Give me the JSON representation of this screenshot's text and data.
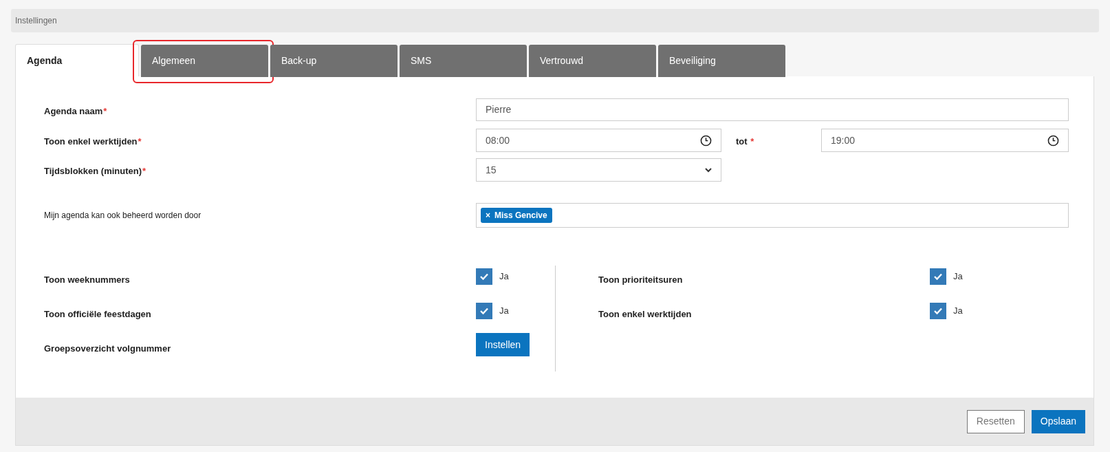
{
  "header": {
    "title": "Instellingen"
  },
  "tabs": [
    {
      "label": "Agenda",
      "selected": true,
      "highlighted": false
    },
    {
      "label": "Algemeen",
      "selected": false,
      "highlighted": true
    },
    {
      "label": "Back-up",
      "selected": false,
      "highlighted": false
    },
    {
      "label": "SMS",
      "selected": false,
      "highlighted": false
    },
    {
      "label": "Vertrouwd",
      "selected": false,
      "highlighted": false
    },
    {
      "label": "Beveiliging",
      "selected": false,
      "highlighted": false
    }
  ],
  "form": {
    "name_label": "Agenda naam",
    "name_value": "Pierre",
    "hours_label": "Toon enkel werktijden",
    "from_value": "08:00",
    "to_label": "tot",
    "to_value": "19:00",
    "blocks_label": "Tijdsblokken (minuten)",
    "blocks_value": "15",
    "managers_label": "Mijn agenda kan ook beheerd worden door",
    "managers": [
      {
        "remove": "×",
        "name": "Miss Gencive"
      }
    ],
    "required_mark": "*"
  },
  "left_options": [
    {
      "kind": "checkbox",
      "label": "Toon weeknummers",
      "checked": true,
      "text": "Ja"
    },
    {
      "kind": "checkbox",
      "label": "Toon officiële feestdagen",
      "checked": true,
      "text": "Ja"
    },
    {
      "kind": "button",
      "label": "Groepsoverzicht volgnummer",
      "text": "Instellen"
    }
  ],
  "right_options": [
    {
      "kind": "checkbox",
      "label": "Toon prioriteitsuren",
      "checked": true,
      "text": "Ja"
    },
    {
      "kind": "checkbox",
      "label": "Toon enkel werktijden",
      "checked": true,
      "text": "Ja"
    }
  ],
  "footer": {
    "reset": "Resetten",
    "save": "Opslaan"
  }
}
